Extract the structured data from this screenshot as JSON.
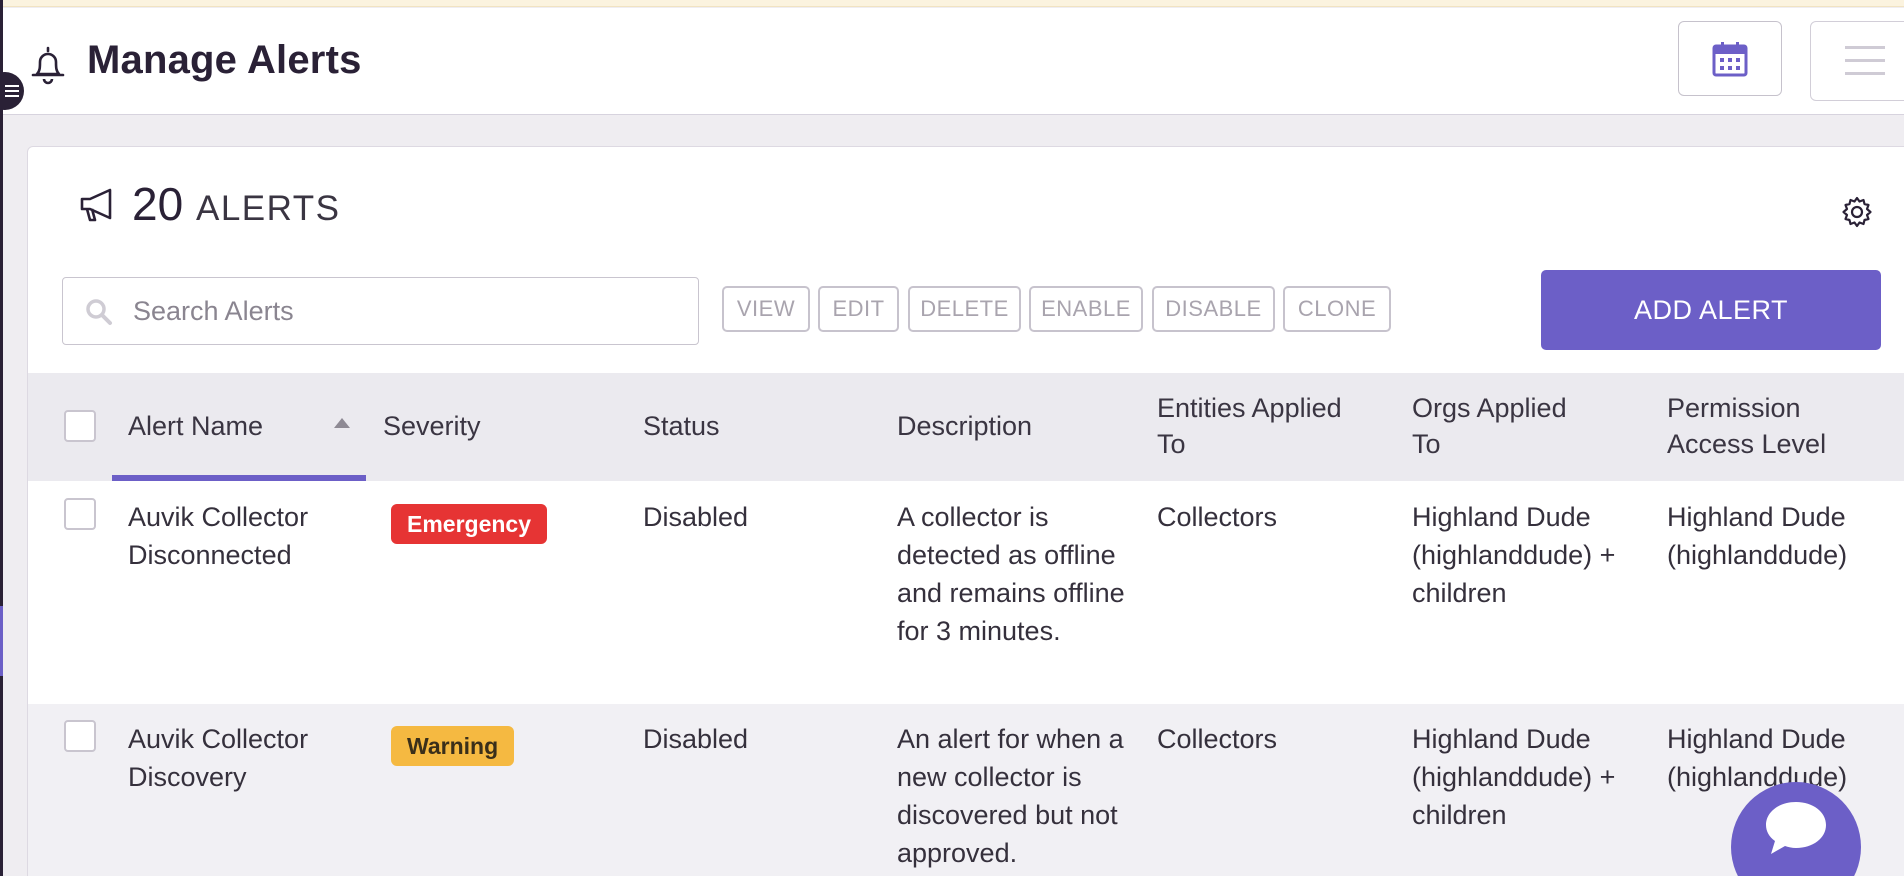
{
  "header": {
    "title": "Manage Alerts"
  },
  "summary": {
    "count": "20",
    "label": "ALERTS"
  },
  "search": {
    "placeholder": "Search Alerts",
    "value": ""
  },
  "toolbar": {
    "view": "VIEW",
    "edit": "EDIT",
    "delete": "DELETE",
    "enable": "ENABLE",
    "disable": "DISABLE",
    "clone": "CLONE",
    "add": "ADD ALERT"
  },
  "table": {
    "columns": {
      "name": "Alert Name",
      "severity": "Severity",
      "status": "Status",
      "description": "Description",
      "entities": "Entities Applied To",
      "orgs": "Orgs Applied To",
      "permission": "Permission Access Level"
    },
    "sort": {
      "column": "Alert Name",
      "direction": "ascending"
    },
    "rows": [
      {
        "name": "Auvik Collector Disconnected",
        "severity": "Emergency",
        "severity_color": "#e63434",
        "status": "Disabled",
        "description": "A collector is detected as offline and remains offline for 3 minutes.",
        "entities": "Collectors",
        "orgs": "Highland Dude (highlanddude) + children",
        "permission": "Highland Dude (highlanddude)"
      },
      {
        "name": "Auvik Collector Discovery",
        "severity": "Warning",
        "severity_color": "#f5b941",
        "status": "Disabled",
        "description": "An alert for when a new collector is discovered but not approved.",
        "entities": "Collectors",
        "orgs": "Highland Dude (highlanddude) + children",
        "permission": "Highland Dude (highlanddude)"
      }
    ]
  },
  "theme": {
    "accent": "#6c5fc7",
    "sidebar": "#2a2136"
  },
  "icons": {
    "header": "bell-icon",
    "summary": "megaphone-icon",
    "settings": "gear-icon",
    "search": "search-icon",
    "calendar": "calendar-icon",
    "menu": "hamburger-icon",
    "chat": "chat-icon"
  }
}
